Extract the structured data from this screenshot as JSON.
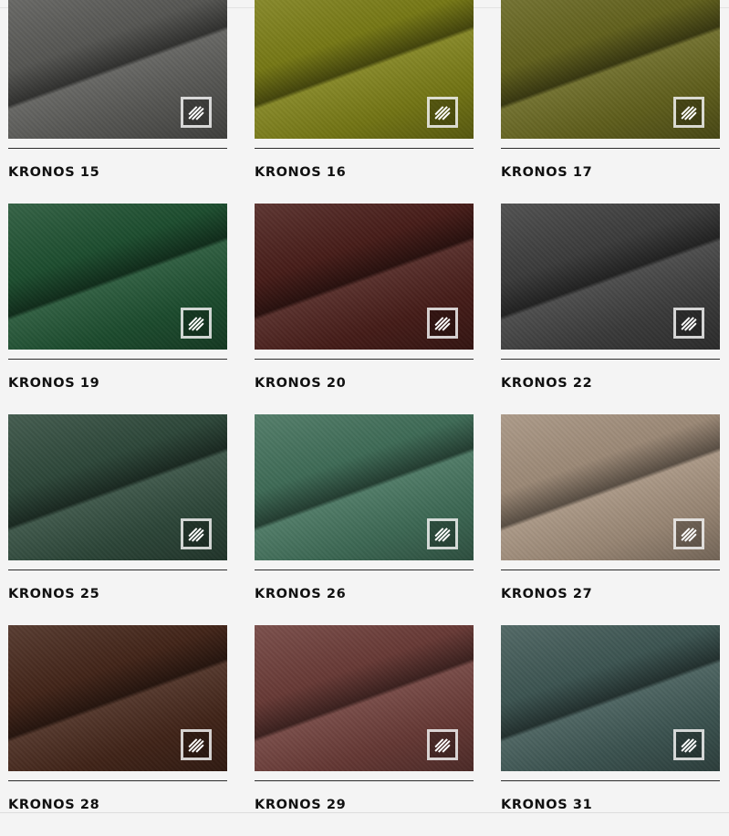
{
  "products": [
    {
      "name": "KRONOS 15",
      "color": "#5a5a57"
    },
    {
      "name": "KRONOS 16",
      "color": "#7c7e16"
    },
    {
      "name": "KRONOS 17",
      "color": "#66651e"
    },
    {
      "name": "KRONOS 19",
      "color": "#1e5131"
    },
    {
      "name": "KRONOS 20",
      "color": "#4a1e1a"
    },
    {
      "name": "KRONOS 22",
      "color": "#3e3e3e"
    },
    {
      "name": "KRONOS 25",
      "color": "#2f4a3c"
    },
    {
      "name": "KRONOS 26",
      "color": "#41705a"
    },
    {
      "name": "KRONOS 27",
      "color": "#a38f7c"
    },
    {
      "name": "KRONOS 28",
      "color": "#45261a"
    },
    {
      "name": "KRONOS 29",
      "color": "#6c3c38"
    },
    {
      "name": "KRONOS 31",
      "color": "#3f5855"
    }
  ],
  "badge_icon": "fabric-texture-icon"
}
